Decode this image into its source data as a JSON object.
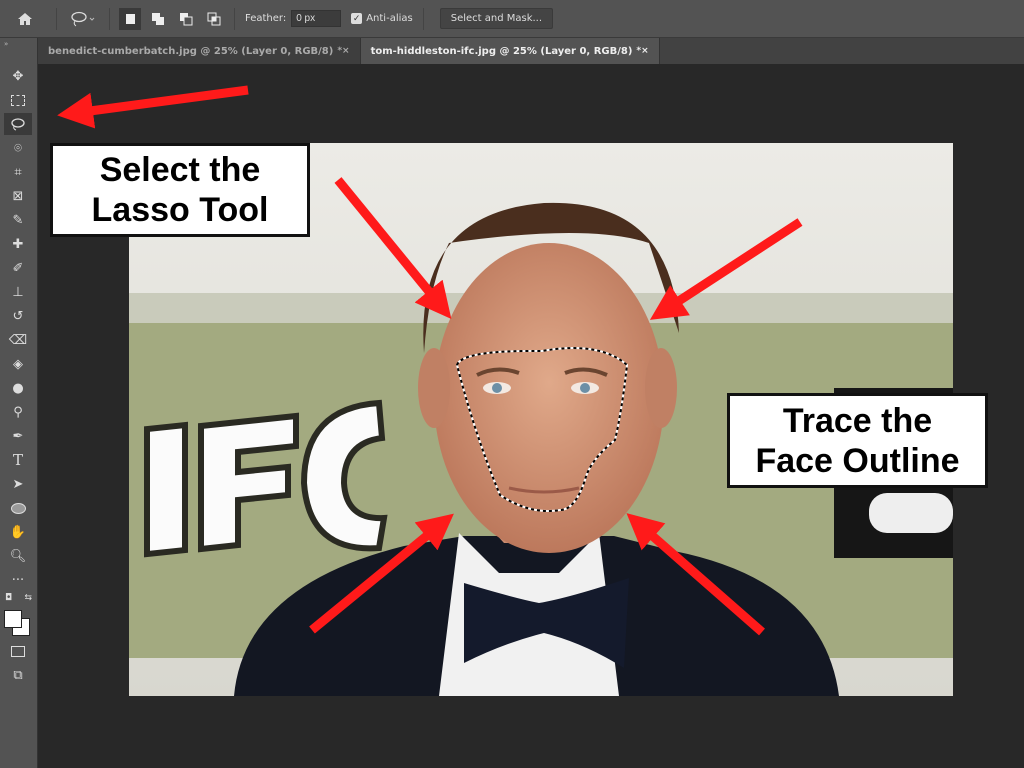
{
  "options_bar": {
    "feather_label": "Feather:",
    "feather_value": "0 px",
    "antialias_label": "Anti-alias",
    "antialias_checked": true,
    "select_mask_label": "Select and Mask..."
  },
  "tabs": [
    {
      "label": "benedict-cumberbatch.jpg @ 25% (Layer 0, RGB/8)",
      "close": "*×",
      "active": false
    },
    {
      "label": "tom-hiddleston-ifc.jpg @ 25% (Layer 0, RGB/8)",
      "close": "*×",
      "active": true
    }
  ],
  "tools": [
    "move",
    "rectangular-marquee",
    "lasso",
    "quick-selection",
    "crop",
    "frame",
    "eyedropper",
    "healing-brush",
    "brush",
    "clone-stamp",
    "history-brush",
    "eraser",
    "paint-bucket",
    "blur",
    "dodge",
    "pen",
    "type",
    "path-selection",
    "ellipse",
    "hand",
    "zoom",
    "more",
    "default-colors",
    "swap-colors",
    "color-swatches",
    "quick-mask",
    "screen-mode"
  ],
  "active_tool": "lasso",
  "image": {
    "sign_text": "IFC"
  },
  "callouts": {
    "lasso": [
      "Select the",
      "Lasso Tool"
    ],
    "trace": [
      "Trace the",
      "Face Outline"
    ]
  },
  "colors": {
    "arrow": "#ff1a1a"
  }
}
